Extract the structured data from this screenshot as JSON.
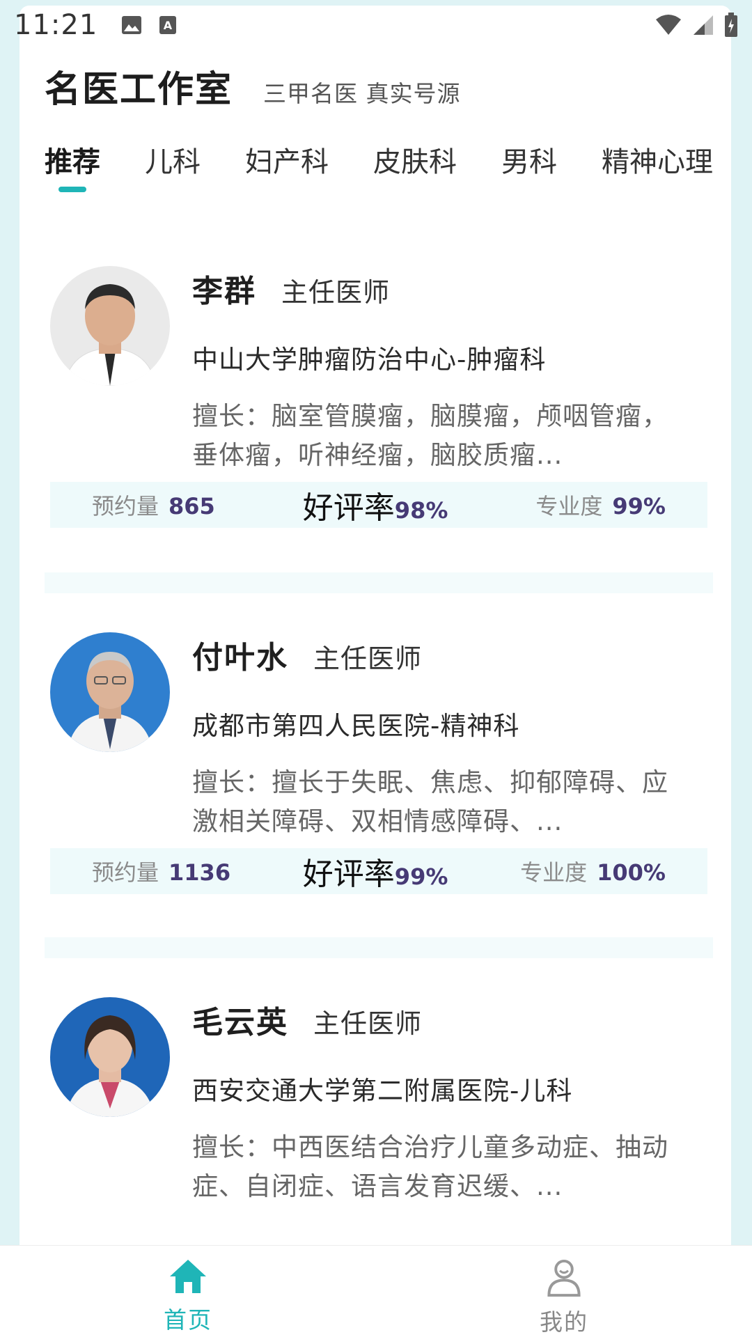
{
  "status_bar": {
    "time": "11:21"
  },
  "header": {
    "title": "名医工作室",
    "subtitle": "三甲名医 真实号源"
  },
  "tabs": [
    {
      "label": "推荐",
      "active": true
    },
    {
      "label": "儿科"
    },
    {
      "label": "妇产科"
    },
    {
      "label": "皮肤科"
    },
    {
      "label": "男科"
    },
    {
      "label": "精神心理"
    }
  ],
  "doctors": [
    {
      "name": "李群",
      "title": "主任医师",
      "hospital": "中山大学肿瘤防治中心-肿瘤科",
      "skill": "擅长：脑室管膜瘤，脑膜瘤，颅咽管瘤，垂体瘤，听神经瘤，脑胶质瘤...",
      "appointments_label": "预约量",
      "appointments": "865",
      "rating_label": "好评率",
      "rating": "98%",
      "professional_label": "专业度",
      "professional": "99%"
    },
    {
      "name": "付叶水",
      "title": "主任医师",
      "hospital": "成都市第四人民医院-精神科",
      "skill": "擅长：擅长于失眠、焦虑、抑郁障碍、应激相关障碍、双相情感障碍、...",
      "appointments_label": "预约量",
      "appointments": "1136",
      "rating_label": "好评率",
      "rating": "99%",
      "professional_label": "专业度",
      "professional": "100%"
    },
    {
      "name": "毛云英",
      "title": "主任医师",
      "hospital": "西安交通大学第二附属医院-儿科",
      "skill": "擅长：中西医结合治疗儿童多动症、抽动症、自闭症、语言发育迟缓、..."
    }
  ],
  "bottom_nav": {
    "home": "首页",
    "mine": "我的"
  },
  "colors": {
    "accent": "#1fb5b7",
    "stat_value": "#463a75",
    "stats_bg": "#eefafb"
  }
}
